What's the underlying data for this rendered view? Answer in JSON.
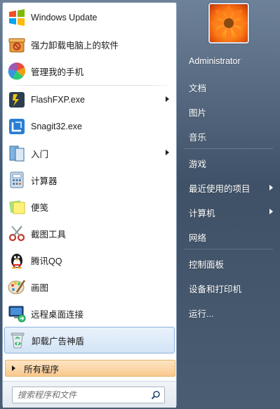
{
  "programs": [
    {
      "label": "Windows Update",
      "icon": "windows-update-icon",
      "submenu": false
    },
    {
      "label": "强力卸载电脑上的软件",
      "icon": "uninstall-box-icon",
      "submenu": false
    },
    {
      "label": "管理我的手机",
      "icon": "phone-manager-icon",
      "submenu": false
    },
    {
      "label": "FlashFXP.exe",
      "icon": "flashfxp-icon",
      "submenu": true
    },
    {
      "label": "Snagit32.exe",
      "icon": "snagit-icon",
      "submenu": false
    },
    {
      "label": "入门",
      "icon": "getting-started-icon",
      "submenu": true
    },
    {
      "label": "计算器",
      "icon": "calculator-icon",
      "submenu": false
    },
    {
      "label": "便笺",
      "icon": "sticky-notes-icon",
      "submenu": false
    },
    {
      "label": "截图工具",
      "icon": "snipping-tool-icon",
      "submenu": false
    },
    {
      "label": "腾讯QQ",
      "icon": "qq-penguin-icon",
      "submenu": false
    },
    {
      "label": "画图",
      "icon": "paint-icon",
      "submenu": false
    },
    {
      "label": "远程桌面连接",
      "icon": "remote-desktop-icon",
      "submenu": false
    },
    {
      "label": "卸载广告神盾",
      "icon": "recycle-bin-icon",
      "submenu": false,
      "highlighted": true
    }
  ],
  "all_programs": {
    "label": "所有程序"
  },
  "search": {
    "placeholder": "搜索程序和文件"
  },
  "right": {
    "user": "Administrator",
    "items": [
      "文档",
      "图片",
      "音乐",
      "游戏",
      "最近使用的项目",
      "计算机",
      "网络",
      "控制面板",
      "设备和打印机",
      "运行..."
    ]
  },
  "colors": {
    "highlight": "#d3e4f6",
    "all_programs": "#f8c98e",
    "right_panel": "#4a5d72"
  }
}
